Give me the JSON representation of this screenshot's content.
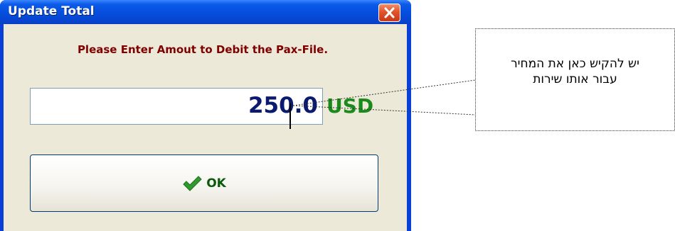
{
  "window": {
    "title": "Update Total",
    "close_icon": "close-icon"
  },
  "form": {
    "prompt": "Please Enter Amout to Debit the Pax-File.",
    "amount_value": "250.0",
    "currency": "USD"
  },
  "ok_button": {
    "label": "OK",
    "icon": "checkmark-icon"
  },
  "annotation": {
    "line1": "יש להקיש כאן את המחיר",
    "line2": "עבור אותו שירות"
  },
  "colors": {
    "titlebar": "#0650df",
    "prompt": "#800000",
    "amount": "#0a1a6e",
    "currency": "#1a8a1a",
    "ok_label": "#0a5a0a"
  }
}
